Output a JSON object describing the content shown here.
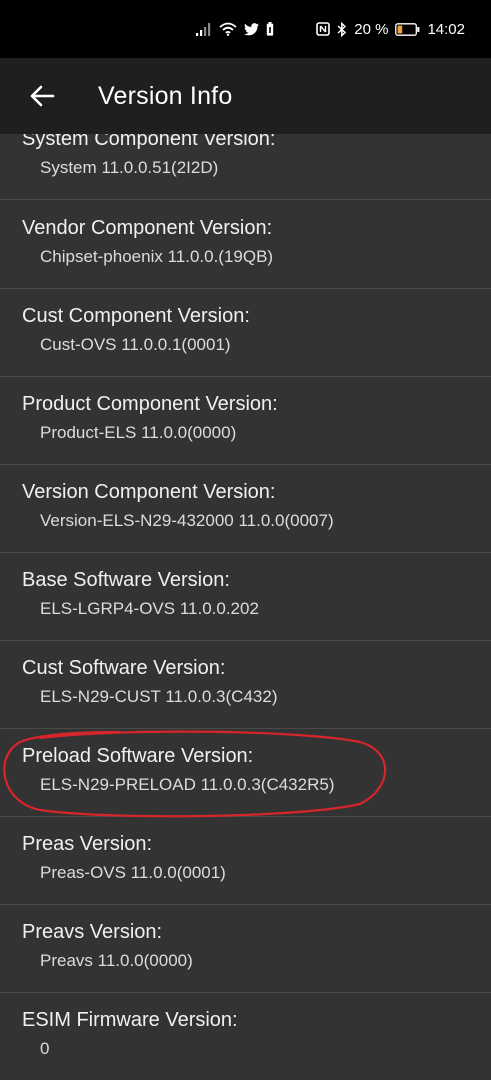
{
  "status_bar": {
    "battery_percent": "20 %",
    "time": "14:02",
    "icons": [
      "signal-icon",
      "wifi-icon",
      "twitter-icon",
      "battery-saver-icon",
      "nfc-icon",
      "bluetooth-icon",
      "battery-icon"
    ]
  },
  "app_bar": {
    "back_icon": "arrow-left-icon",
    "title": "Version Info"
  },
  "items": [
    {
      "label": "System Component Version:",
      "value": "System 11.0.0.51(2I2D)"
    },
    {
      "label": "Vendor Component Version:",
      "value": "Chipset-phoenix 11.0.0.(19QB)"
    },
    {
      "label": "Cust Component Version:",
      "value": "Cust-OVS 11.0.0.1(0001)"
    },
    {
      "label": "Product Component Version:",
      "value": "Product-ELS 11.0.0(0000)"
    },
    {
      "label": "Version Component Version:",
      "value": "Version-ELS-N29-432000 11.0.0(0007)"
    },
    {
      "label": "Base Software Version:",
      "value": "ELS-LGRP4-OVS 11.0.0.202"
    },
    {
      "label": "Cust Software Version:",
      "value": "ELS-N29-CUST 11.0.0.3(C432)"
    },
    {
      "label": "Preload Software Version:",
      "value": "ELS-N29-PRELOAD 11.0.0.3(C432R5)"
    },
    {
      "label": "Preas Version:",
      "value": "Preas-OVS 11.0.0(0001)"
    },
    {
      "label": "Preavs Version:",
      "value": "Preavs 11.0.0(0000)"
    },
    {
      "label": "ESIM Firmware Version:",
      "value": "0"
    }
  ],
  "annotation": {
    "color": "#d4262b",
    "shape": "hand-drawn-ellipse",
    "highlighted_item": "Preload Software Version:"
  }
}
